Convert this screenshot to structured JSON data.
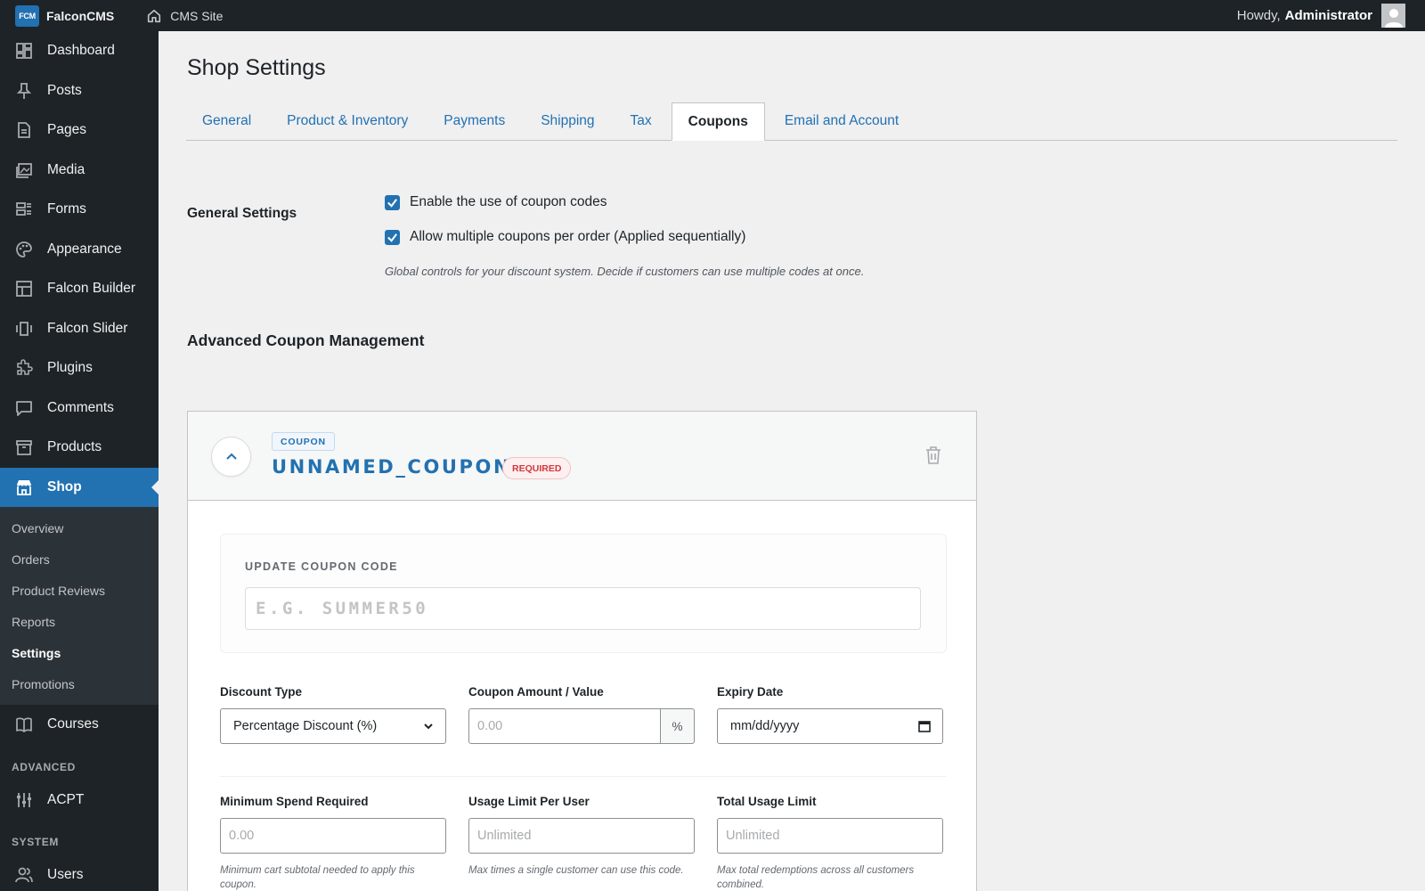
{
  "adminbar": {
    "logo_text": "FCM",
    "brand": "FalconCMS",
    "site_link": "CMS Site",
    "greeting": "Howdy,",
    "user": "Administrator"
  },
  "sidebar": {
    "items": [
      {
        "label": "Dashboard",
        "icon": "dashboard-icon"
      },
      {
        "label": "Posts",
        "icon": "pin-icon"
      },
      {
        "label": "Pages",
        "icon": "page-icon"
      },
      {
        "label": "Media",
        "icon": "media-icon"
      },
      {
        "label": "Forms",
        "icon": "forms-icon"
      },
      {
        "label": "Appearance",
        "icon": "palette-icon"
      },
      {
        "label": "Falcon Builder",
        "icon": "layout-icon"
      },
      {
        "label": "Falcon Slider",
        "icon": "slider-icon"
      },
      {
        "label": "Plugins",
        "icon": "plugin-icon"
      },
      {
        "label": "Comments",
        "icon": "comment-icon"
      },
      {
        "label": "Products",
        "icon": "archive-icon"
      },
      {
        "label": "Shop",
        "icon": "store-icon"
      }
    ],
    "shop_submenu": [
      "Overview",
      "Orders",
      "Product Reviews",
      "Reports",
      "Settings",
      "Promotions"
    ],
    "courses": "Courses",
    "section_advanced": "ADVANCED",
    "acpt": "ACPT",
    "section_system": "SYSTEM",
    "users": "Users"
  },
  "page": {
    "title": "Shop Settings",
    "tabs": [
      "General",
      "Product & Inventory",
      "Payments",
      "Shipping",
      "Tax",
      "Coupons",
      "Email and Account"
    ],
    "active_tab": "Coupons"
  },
  "general_settings": {
    "label": "General Settings",
    "option_1": "Enable the use of coupon codes",
    "option_2": "Allow multiple coupons per order (Applied sequentially)",
    "description": "Global controls for your discount system. Decide if customers can use multiple codes at once."
  },
  "advanced": {
    "title": "Advanced Coupon Management"
  },
  "coupon": {
    "tag": "COUPON",
    "name": "UNNAMED_COUPON",
    "badge": "REQUIRED",
    "code_label": "UPDATE COUPON CODE",
    "code_placeholder": "E.G. SUMMER50",
    "discount_type_label": "Discount Type",
    "discount_type_value": "Percentage Discount (%)",
    "amount_label": "Coupon Amount / Value",
    "amount_placeholder": "0.00",
    "amount_suffix": "%",
    "expiry_label": "Expiry Date",
    "expiry_placeholder": "mm/dd/yyyy",
    "min_spend_label": "Minimum Spend Required",
    "min_spend_placeholder": "0.00",
    "min_spend_help": "Minimum cart subtotal needed to apply this coupon.",
    "per_user_label": "Usage Limit Per User",
    "per_user_placeholder": "Unlimited",
    "per_user_help": "Max times a single customer can use this code.",
    "total_label": "Total Usage Limit",
    "total_placeholder": "Unlimited",
    "total_help": "Max total redemptions across all customers combined."
  },
  "colors": {
    "accent": "#2271b1",
    "sidebar_bg": "#1d2327",
    "danger": "#d63638"
  }
}
